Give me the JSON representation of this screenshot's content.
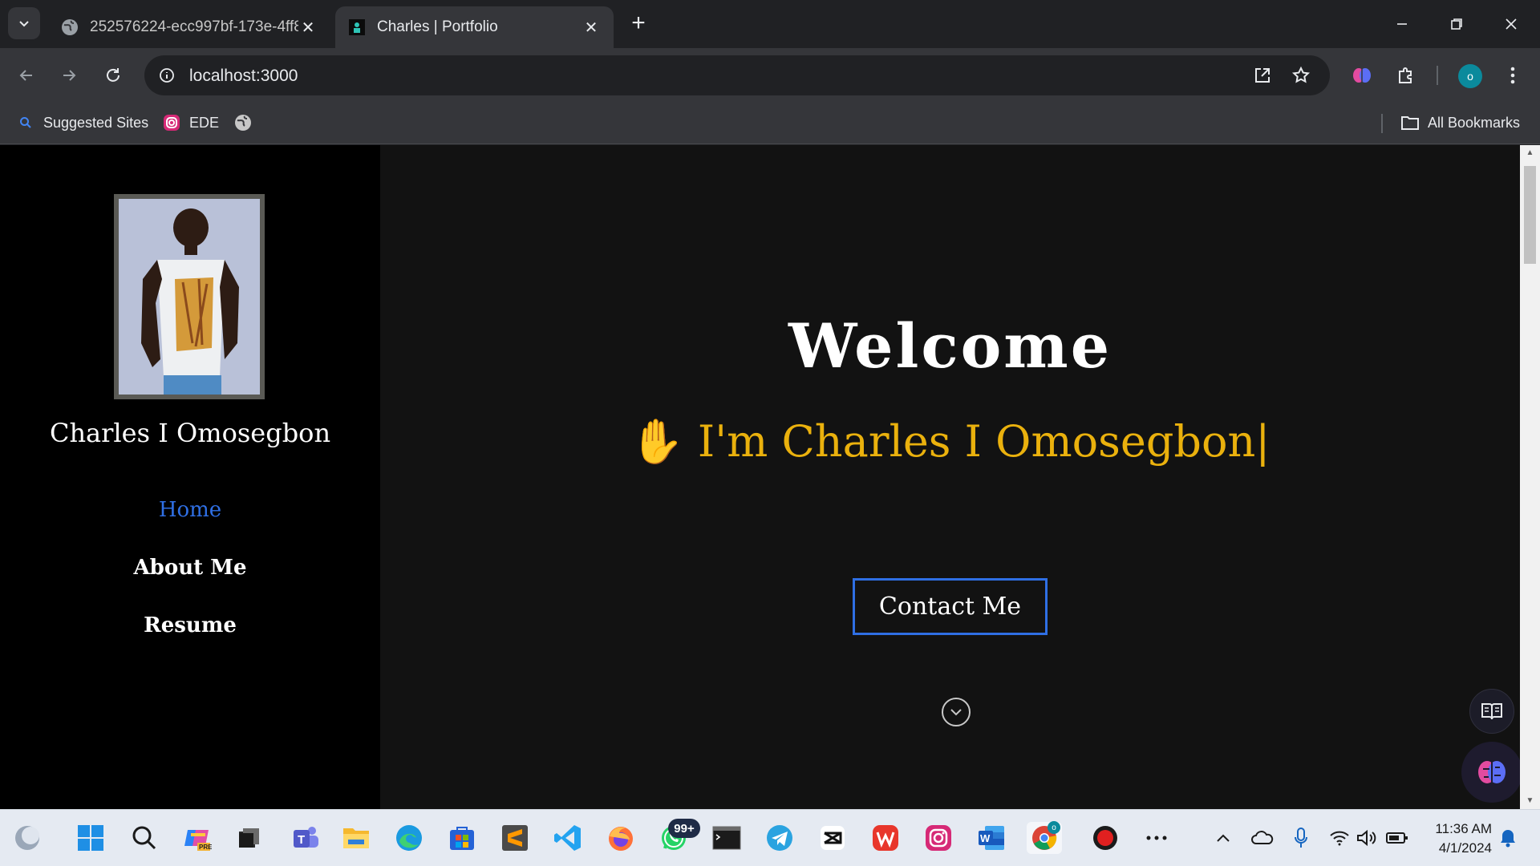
{
  "browser": {
    "tabs": [
      {
        "title": "252576224-ecc997bf-173e-4ff8",
        "favicon": "globe-icon",
        "active": false
      },
      {
        "title": "Charles | Portfolio",
        "favicon": "site-favicon-icon",
        "active": true
      }
    ],
    "address": "localhost:3000",
    "bookmarks": [
      {
        "label": "Suggested Sites",
        "icon": "search-icon"
      },
      {
        "label": "EDE",
        "icon": "instagram-icon"
      },
      {
        "label": "",
        "icon": "globe-icon"
      }
    ],
    "all_bookmarks_label": "All Bookmarks",
    "profile_initial": "o"
  },
  "sidebar": {
    "name": "Charles I Omosegbon",
    "nav": [
      {
        "label": "Home",
        "active": true
      },
      {
        "label": "About Me",
        "active": false
      },
      {
        "label": "Resume",
        "active": false
      }
    ]
  },
  "hero": {
    "welcome": "Welcome",
    "intro": "✋ I'm Charles I Omosegbon|",
    "contact_button": "Contact Me"
  },
  "taskbar": {
    "whatsapp_badge": "99+",
    "chrome_badge": "o",
    "time": "11:36 AM",
    "date": "4/1/2024"
  },
  "colors": {
    "accent_blue": "#2f6fe4",
    "intro_yellow": "#eab10d",
    "page_background": "#121212",
    "sidebar_background": "#000000"
  }
}
